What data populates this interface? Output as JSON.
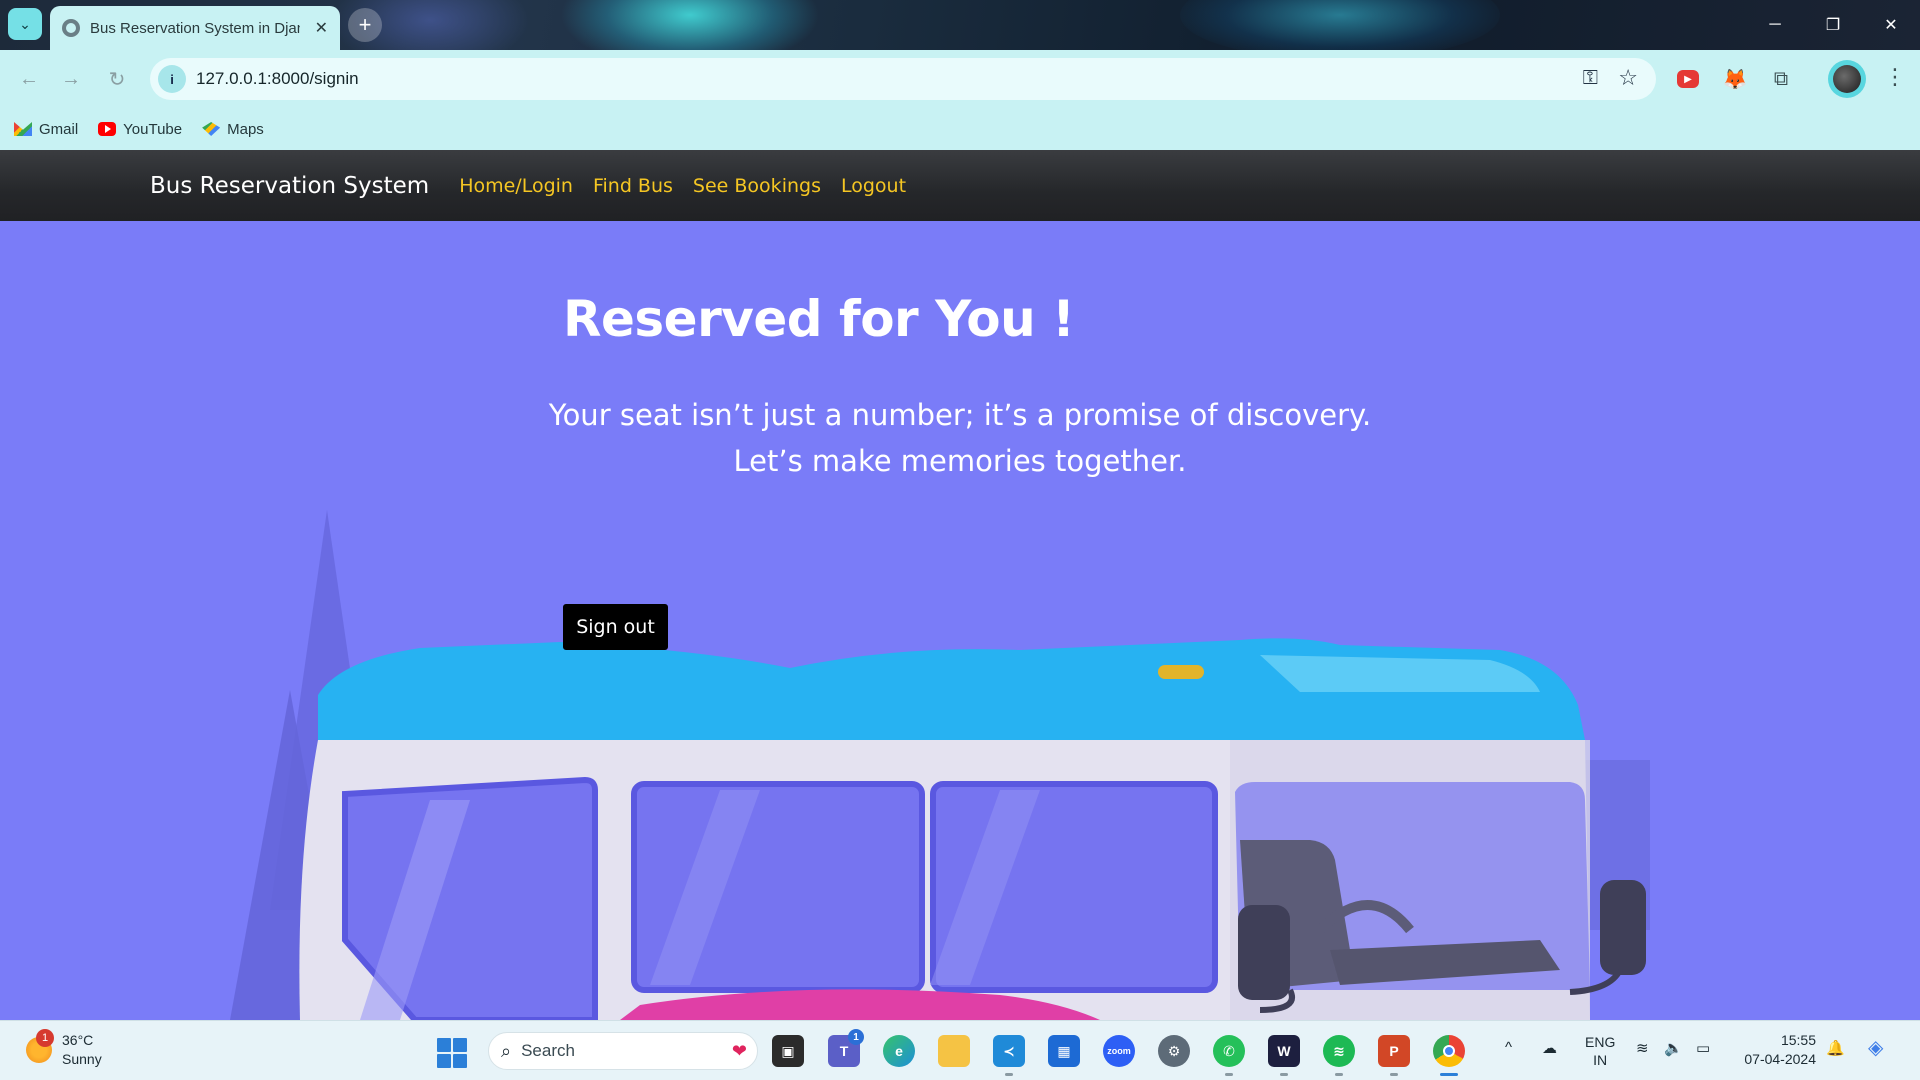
{
  "browser": {
    "tab_title": "Bus Reservation System in Djan",
    "tab_close": "✕",
    "new_tab": "+",
    "url": "127.0.0.1:8000/signin",
    "window_controls": {
      "minimize": "─",
      "restore": "❐",
      "close": "✕"
    },
    "bookmarks": [
      {
        "label": "Gmail",
        "icon": "gmail-icon"
      },
      {
        "label": "YouTube",
        "icon": "youtube-icon"
      },
      {
        "label": "Maps",
        "icon": "maps-icon"
      }
    ]
  },
  "site": {
    "brand": "Bus Reservation System",
    "nav": [
      "Home/Login",
      "Find Bus",
      "See Bookings",
      "Logout"
    ],
    "hero_title": "Reserved for You !",
    "hero_line1": "Your seat isn’t just a number; it’s a promise of discovery.",
    "hero_line2": "Let’s make memories together.",
    "signout_label": "Sign out",
    "colors": {
      "background": "#7a7cf8",
      "navbar": "#232427",
      "nav_link": "#f5c623",
      "button": "#000000"
    }
  },
  "taskbar": {
    "weather_temp": "36°C",
    "weather_desc": "Sunny",
    "weather_badge": "1",
    "search_label": "Search",
    "teams_badge": "1",
    "lang_top": "ENG",
    "lang_bottom": "IN",
    "time": "15:55",
    "date": "07-04-2024"
  }
}
